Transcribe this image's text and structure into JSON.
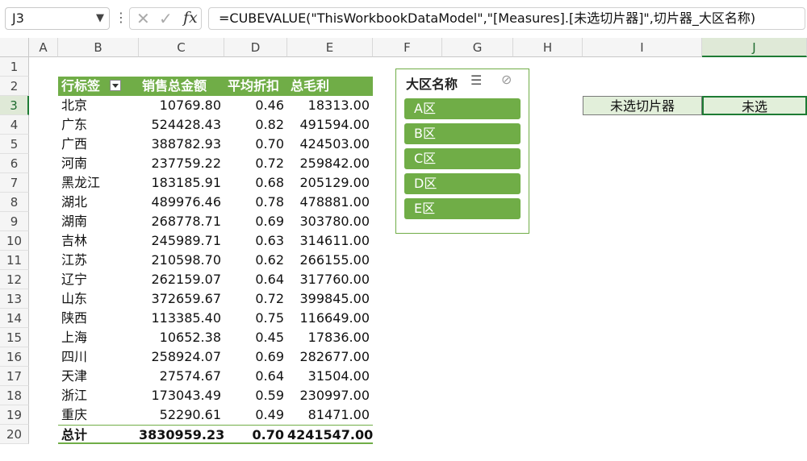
{
  "formula_bar": {
    "name_box": "J3",
    "fx_label": "fx",
    "cancel_glyph": "✕",
    "enter_glyph": "✓",
    "formula": "=CUBEVALUE(\"ThisWorkbookDataModel\",\"[Measures].[未选切片器]\",切片器_大区名称)"
  },
  "columns": [
    "A",
    "B",
    "C",
    "D",
    "E",
    "F",
    "G",
    "H",
    "I",
    "J"
  ],
  "rows": [
    "1",
    "2",
    "3",
    "4",
    "5",
    "6",
    "7",
    "8",
    "9",
    "10",
    "11",
    "12",
    "13",
    "14",
    "15",
    "16",
    "17",
    "18",
    "19",
    "20"
  ],
  "pivot": {
    "headers": {
      "label": "行标签",
      "sales": "销售总金额",
      "discount": "平均折扣",
      "profit": "总毛利"
    },
    "rows": [
      {
        "label": "北京",
        "sales": "10769.80",
        "discount": "0.46",
        "profit": "18313.00"
      },
      {
        "label": "广东",
        "sales": "524428.43",
        "discount": "0.82",
        "profit": "491594.00"
      },
      {
        "label": "广西",
        "sales": "388782.93",
        "discount": "0.70",
        "profit": "424503.00"
      },
      {
        "label": "河南",
        "sales": "237759.22",
        "discount": "0.72",
        "profit": "259842.00"
      },
      {
        "label": "黑龙江",
        "sales": "183185.91",
        "discount": "0.68",
        "profit": "205129.00"
      },
      {
        "label": "湖北",
        "sales": "489976.46",
        "discount": "0.78",
        "profit": "478881.00"
      },
      {
        "label": "湖南",
        "sales": "268778.71",
        "discount": "0.69",
        "profit": "303780.00"
      },
      {
        "label": "吉林",
        "sales": "245989.71",
        "discount": "0.63",
        "profit": "314611.00"
      },
      {
        "label": "江苏",
        "sales": "210598.70",
        "discount": "0.62",
        "profit": "266155.00"
      },
      {
        "label": "辽宁",
        "sales": "262159.07",
        "discount": "0.64",
        "profit": "317760.00"
      },
      {
        "label": "山东",
        "sales": "372659.67",
        "discount": "0.72",
        "profit": "399845.00"
      },
      {
        "label": "陕西",
        "sales": "113385.40",
        "discount": "0.75",
        "profit": "116649.00"
      },
      {
        "label": "上海",
        "sales": "10652.38",
        "discount": "0.45",
        "profit": "17836.00"
      },
      {
        "label": "四川",
        "sales": "258924.07",
        "discount": "0.69",
        "profit": "282677.00"
      },
      {
        "label": "天津",
        "sales": "27574.67",
        "discount": "0.64",
        "profit": "31504.00"
      },
      {
        "label": "浙江",
        "sales": "173043.49",
        "discount": "0.59",
        "profit": "230997.00"
      },
      {
        "label": "重庆",
        "sales": "52290.61",
        "discount": "0.49",
        "profit": "81471.00"
      }
    ],
    "total": {
      "label": "总计",
      "sales": "3830959.23",
      "discount": "0.70",
      "profit": "4241547.00"
    }
  },
  "slicer": {
    "title": "大区名称",
    "items": [
      "A区",
      "B区",
      "C区",
      "D区",
      "E区"
    ],
    "multi_select_icon": "multi-select-icon",
    "clear_filter_icon": "clear-filter-icon"
  },
  "cells": {
    "I3": "未选切片器",
    "J3": "未选"
  },
  "colors": {
    "accent_green": "#70ad47",
    "selection_green": "#1e7b34",
    "light_green": "#e2efda"
  }
}
